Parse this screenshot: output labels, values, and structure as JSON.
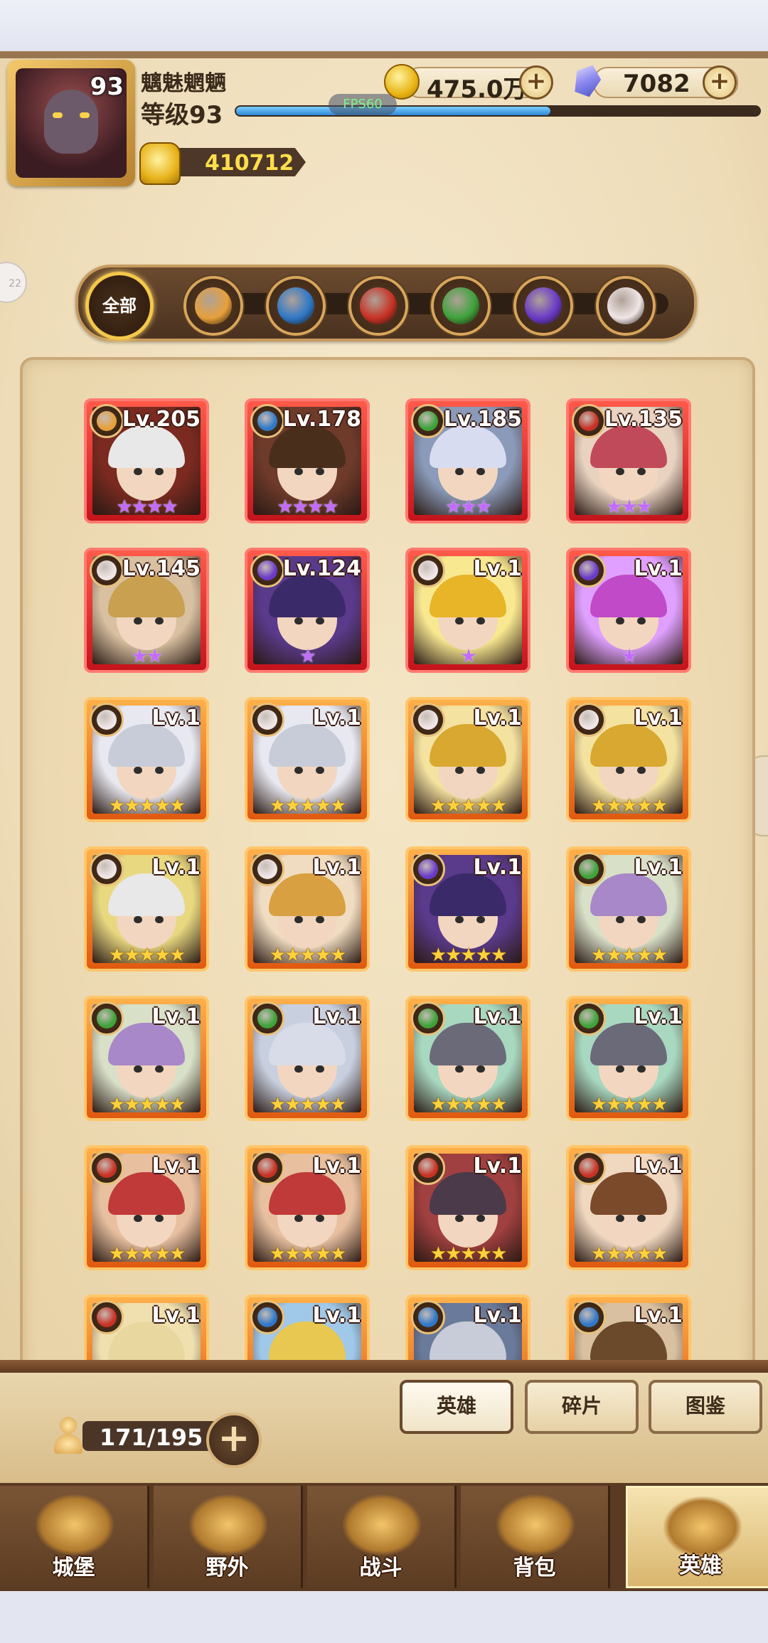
{
  "player": {
    "name": "魑魅魍魉",
    "level_label": "等级93",
    "avatar_level": "93",
    "xp_fraction": 0.6,
    "power": "410712"
  },
  "resources": {
    "gold": "475.0万",
    "gems": "7082"
  },
  "debug": {
    "fps": "FPS60"
  },
  "side_button": "22",
  "filters": {
    "all_label": "全部",
    "items": [
      {
        "name": "beast",
        "icon": "paw-icon",
        "color": "#e8a03a"
      },
      {
        "name": "tech",
        "icon": "gear-orb-icon",
        "color": "#2f78c8"
      },
      {
        "name": "fortress",
        "icon": "crest-icon",
        "color": "#c83224"
      },
      {
        "name": "nature",
        "icon": "leaf-icon",
        "color": "#3ea23a"
      },
      {
        "name": "shadow",
        "icon": "moon-icon",
        "color": "#6a3ac8"
      },
      {
        "name": "light",
        "icon": "diamond-icon",
        "color": "#f0e6e6"
      }
    ]
  },
  "heroes": [
    {
      "lv": "Lv.205",
      "elem": "beast",
      "frame": "red",
      "stars": "★★★★",
      "star_color": "purple",
      "hair": "#e8e8e8",
      "bg": "#7a2a20"
    },
    {
      "lv": "Lv.178",
      "elem": "tech",
      "frame": "red",
      "stars": "★★★★",
      "star_color": "purple",
      "hair": "#4a2e1c",
      "bg": "#6e3a2a"
    },
    {
      "lv": "Lv.185",
      "elem": "nature",
      "frame": "red",
      "stars": "★★★",
      "star_color": "purple",
      "hair": "#d8dcf0",
      "bg": "#8a9ab8"
    },
    {
      "lv": "Lv.135",
      "elem": "fortress",
      "frame": "red",
      "stars": "★★★",
      "star_color": "purple",
      "hair": "#c04a5a",
      "bg": "#e8d2c0"
    },
    {
      "lv": "Lv.145",
      "elem": "light",
      "frame": "red",
      "stars": "★★",
      "star_color": "purple",
      "hair": "#c8a050",
      "bg": "#d8c0a0"
    },
    {
      "lv": "Lv.124",
      "elem": "shadow",
      "frame": "red",
      "stars": "★",
      "star_color": "purple",
      "hair": "#3a2a6a",
      "bg": "#5a3a8a"
    },
    {
      "lv": "Lv.1",
      "elem": "light",
      "frame": "red",
      "stars": "★",
      "star_color": "purple",
      "hair": "#e8b428",
      "bg": "#f8e890"
    },
    {
      "lv": "Lv.1",
      "elem": "shadow",
      "frame": "red",
      "stars": "★",
      "star_color": "purple",
      "hair": "#c04ac8",
      "bg": "#e0a0ff"
    },
    {
      "lv": "Lv.1",
      "elem": "light",
      "frame": "orange",
      "stars": "★★★★★",
      "star_color": "gold",
      "hair": "#c8ccd8",
      "bg": "#e8e8f0"
    },
    {
      "lv": "Lv.1",
      "elem": "light",
      "frame": "orange",
      "stars": "★★★★★",
      "star_color": "gold",
      "hair": "#c8ccd8",
      "bg": "#e8e8f0"
    },
    {
      "lv": "Lv.1",
      "elem": "light",
      "frame": "orange",
      "stars": "★★★★★",
      "star_color": "gold",
      "hair": "#d8a830",
      "bg": "#f4e2a0"
    },
    {
      "lv": "Lv.1",
      "elem": "light",
      "frame": "orange",
      "stars": "★★★★★",
      "star_color": "gold",
      "hair": "#d8a830",
      "bg": "#f4e2a0"
    },
    {
      "lv": "Lv.1",
      "elem": "light",
      "frame": "orange",
      "stars": "★★★★★",
      "star_color": "gold",
      "hair": "#e8e8e8",
      "bg": "#e8d880"
    },
    {
      "lv": "Lv.1",
      "elem": "light",
      "frame": "orange",
      "stars": "★★★★★",
      "star_color": "gold",
      "hair": "#d8a040",
      "bg": "#f0dcc0"
    },
    {
      "lv": "Lv.1",
      "elem": "shadow",
      "frame": "orange",
      "stars": "★★★★★",
      "star_color": "gold",
      "hair": "#3a2a6a",
      "bg": "#5a3a8a"
    },
    {
      "lv": "Lv.1",
      "elem": "nature",
      "frame": "orange",
      "stars": "★★★★★",
      "star_color": "gold",
      "hair": "#a888c8",
      "bg": "#d8e0c8"
    },
    {
      "lv": "Lv.1",
      "elem": "nature",
      "frame": "orange",
      "stars": "★★★★★",
      "star_color": "gold",
      "hair": "#a888c8",
      "bg": "#d8e0c8"
    },
    {
      "lv": "Lv.1",
      "elem": "nature",
      "frame": "orange",
      "stars": "★★★★★",
      "star_color": "gold",
      "hair": "#d8dce8",
      "bg": "#c8d0e0"
    },
    {
      "lv": "Lv.1",
      "elem": "nature",
      "frame": "orange",
      "stars": "★★★★★",
      "star_color": "gold",
      "hair": "#6a6a78",
      "bg": "#a8d8c0"
    },
    {
      "lv": "Lv.1",
      "elem": "nature",
      "frame": "orange",
      "stars": "★★★★★",
      "star_color": "gold",
      "hair": "#6a6a78",
      "bg": "#a8d8c0"
    },
    {
      "lv": "Lv.1",
      "elem": "fortress",
      "frame": "orange",
      "stars": "★★★★★",
      "star_color": "gold",
      "hair": "#c03a3a",
      "bg": "#e8c0a0"
    },
    {
      "lv": "Lv.1",
      "elem": "fortress",
      "frame": "orange",
      "stars": "★★★★★",
      "star_color": "gold",
      "hair": "#c03a3a",
      "bg": "#e8c0a0"
    },
    {
      "lv": "Lv.1",
      "elem": "fortress",
      "frame": "orange",
      "stars": "★★★★★",
      "star_color": "gold",
      "hair": "#4a3a4a",
      "bg": "#a04040"
    },
    {
      "lv": "Lv.1",
      "elem": "fortress",
      "frame": "orange",
      "stars": "★★★★★",
      "star_color": "gold",
      "hair": "#7a4a2a",
      "bg": "#f0d8c0"
    },
    {
      "lv": "Lv.1",
      "elem": "fortress",
      "frame": "orange",
      "stars": "",
      "star_color": "gold",
      "hair": "#e8d8a0",
      "bg": "#f0e0b0"
    },
    {
      "lv": "Lv.1",
      "elem": "tech",
      "frame": "orange",
      "stars": "",
      "star_color": "gold",
      "hair": "#e8c850",
      "bg": "#a0c8e8"
    },
    {
      "lv": "Lv.1",
      "elem": "tech",
      "frame": "orange",
      "stars": "",
      "star_color": "gold",
      "hair": "#c8ccd8",
      "bg": "#6a7a9a"
    },
    {
      "lv": "Lv.1",
      "elem": "tech",
      "frame": "orange",
      "stars": "",
      "star_color": "gold",
      "hair": "#6a4a2a",
      "bg": "#d8c0a0"
    }
  ],
  "hero_count": "171/195",
  "sub_tabs": [
    {
      "label": "英雄",
      "active": true
    },
    {
      "label": "碎片",
      "active": false
    },
    {
      "label": "图鉴",
      "active": false
    }
  ],
  "nav": [
    {
      "label": "城堡",
      "icon": "castle-base-icon",
      "active": false
    },
    {
      "label": "野外",
      "icon": "field-buildings-icon",
      "active": false
    },
    {
      "label": "战斗",
      "icon": "crossed-swords-icon",
      "active": false
    },
    {
      "label": "背包",
      "icon": "backpack-icon",
      "active": false
    },
    {
      "label": "英雄",
      "icon": "helmet-icon",
      "active": true
    }
  ]
}
